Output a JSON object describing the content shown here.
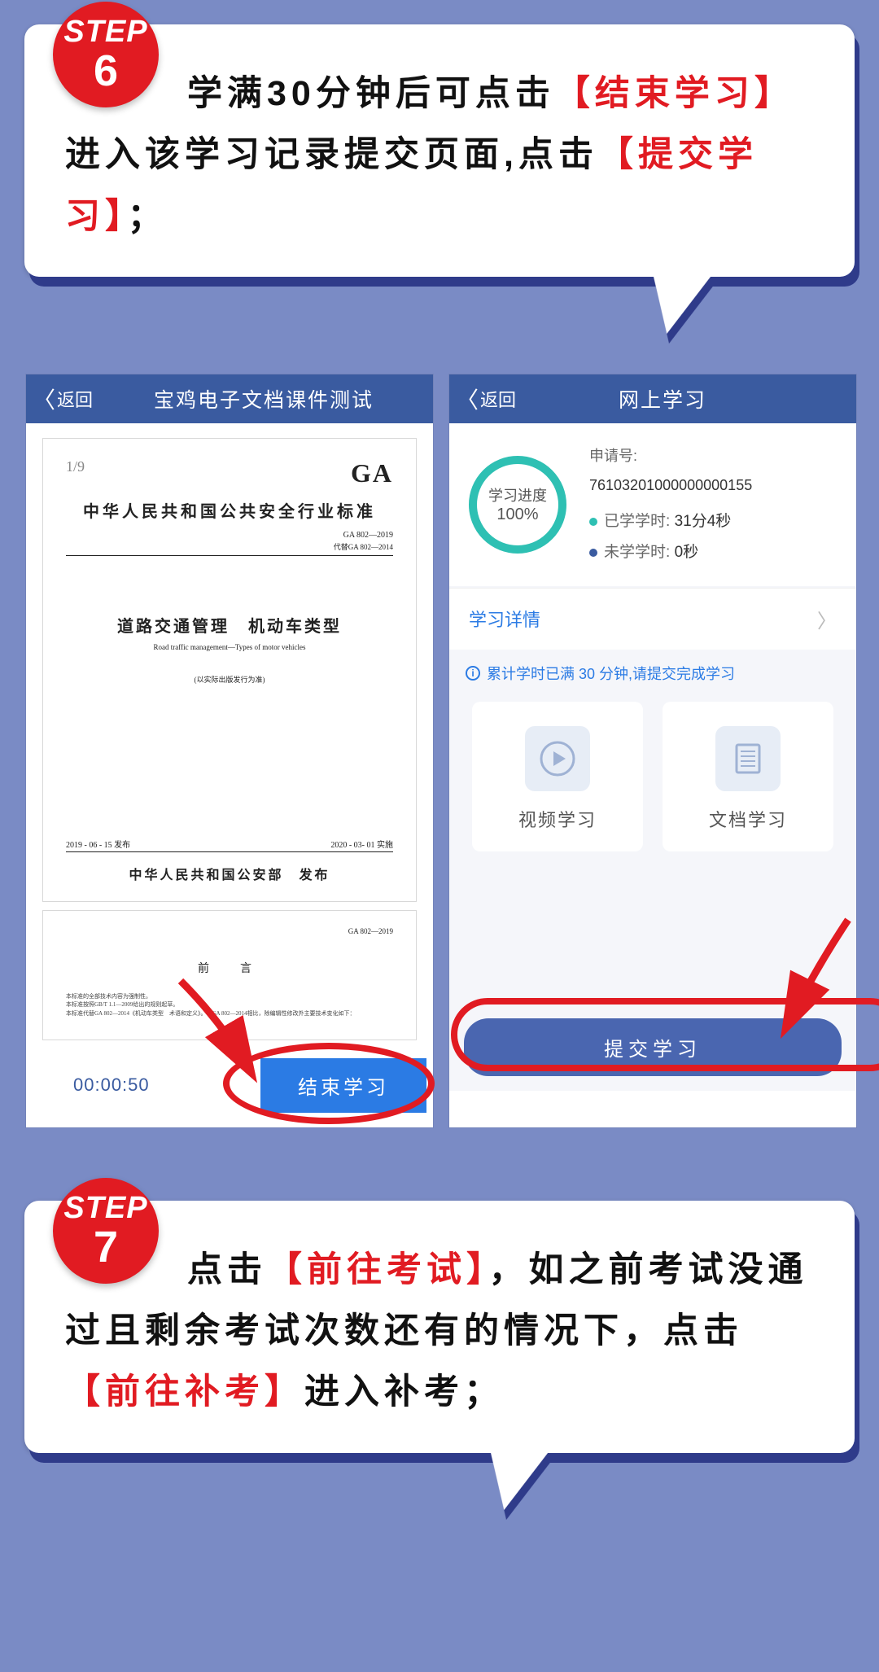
{
  "step6": {
    "badge_label": "STEP",
    "badge_num": "6",
    "text_pre": "学满30分钟后可点击",
    "hl1": "【结束学习】",
    "text_mid": "进入该学习记录提交页面,点击",
    "hl2": "【提交学习】",
    "text_end": "；"
  },
  "phoneA": {
    "back": "返回",
    "title": "宝鸡电子文档课件测试",
    "doc": {
      "page_indicator": "1/9",
      "ga": "GA",
      "std_title": "中华人民共和国公共安全行业标准",
      "std_code1": "GA 802—2019",
      "std_code2": "代替GA 802—2014",
      "main_title": "道路交通管理　机动车类型",
      "main_en": "Road traffic management—Types of motor vehicles",
      "note": "(以实际出版发行为准)",
      "date_left": "2019 - 06 - 15 发布",
      "date_right": "2020 - 03- 01 实施",
      "issuer": "中华人民共和国公安部　发布",
      "page2_code": "GA 802—2019",
      "preface": "前　言",
      "tiny1": "本标准的全部技术内容为强制性。",
      "tiny2": "本标准按照GB/T 1.1—2009给出的规则起草。",
      "tiny3": "本标准代替GA 802—2014《机动车类型　术语和定义》。与GA 802—2014相比，除编辑性修改外主要技术变化如下："
    },
    "timer": "00:00:50",
    "end_button": "结束学习"
  },
  "phoneB": {
    "back": "返回",
    "title": "网上学习",
    "progress_label": "学习进度",
    "progress_pct": "100%",
    "app_label": "申请号:",
    "app_no": "76103201000000000155",
    "studied_label": "已学学时:",
    "studied_val": "31分4秒",
    "unstudied_label": "未学学时:",
    "unstudied_val": "0秒",
    "detail_link": "学习详情",
    "info_note": "累计学时已满 30 分钟,请提交完成学习",
    "video_label": "视频学习",
    "doc_label": "文档学习",
    "submit_button": "提交学习"
  },
  "step7": {
    "badge_label": "STEP",
    "badge_num": "7",
    "text_pre": "点击",
    "hl1": "【前往考试】",
    "text_mid1": "，如之前考试没通过且剩余考试次数还有的情况下，点击",
    "hl2": "【前往补考】",
    "text_end": "进入补考；"
  }
}
